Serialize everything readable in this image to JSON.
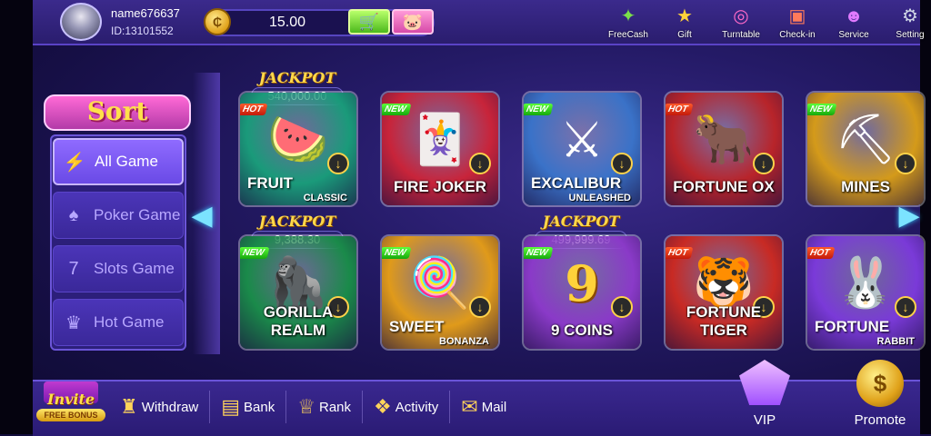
{
  "user": {
    "name": "name676637",
    "id": "ID:13101552"
  },
  "wallet": {
    "balance": "15.00"
  },
  "top_menu": [
    {
      "label": "FreeCash",
      "icon": "freecash-icon",
      "glyph": "✦",
      "color": "#7adf4a"
    },
    {
      "label": "Gift",
      "icon": "gift-icon",
      "glyph": "★",
      "color": "#ffd23a"
    },
    {
      "label": "Turntable",
      "icon": "turntable-icon",
      "glyph": "◎",
      "color": "#ff6ac8"
    },
    {
      "label": "Check-in",
      "icon": "checkin-icon",
      "glyph": "▣",
      "color": "#ff7a5a"
    },
    {
      "label": "Service",
      "icon": "service-icon",
      "glyph": "☻",
      "color": "#e07aff"
    },
    {
      "label": "Setting",
      "icon": "gear-icon",
      "glyph": "⚙",
      "color": "#cfd6e6"
    }
  ],
  "sort": {
    "title": "Sort",
    "items": [
      {
        "label": "All Game",
        "icon": "lightning-icon",
        "glyph": "⚡",
        "active": true
      },
      {
        "label": "Poker Game",
        "icon": "poker-icon",
        "glyph": "♠",
        "active": false
      },
      {
        "label": "Slots Game",
        "icon": "slots-icon",
        "glyph": "7",
        "active": false
      },
      {
        "label": "Hot Game",
        "icon": "crown-icon",
        "glyph": "♛",
        "active": false
      }
    ]
  },
  "games_row1": [
    {
      "name": "FRUIT",
      "sub": "CLASSIC",
      "badge": "HOT",
      "jackpot": "540,000.00",
      "emblem": "🍉",
      "bg": "#1a9a7a"
    },
    {
      "name": "FIRE JOKER",
      "sub": "",
      "badge": "NEW",
      "jackpot": "",
      "emblem": "🃏",
      "bg": "#c8243a"
    },
    {
      "name": "EXCALIBUR",
      "sub": "UNLEASHED",
      "badge": "NEW",
      "jackpot": "",
      "emblem": "⚔",
      "bg": "#3a72c8"
    },
    {
      "name": "FORTUNE OX",
      "sub": "",
      "badge": "HOT",
      "jackpot": "",
      "emblem": "🐂",
      "bg": "#b8242a"
    },
    {
      "name": "MINES",
      "sub": "",
      "badge": "NEW",
      "jackpot": "",
      "emblem": "⛏",
      "bg": "#d49a1a"
    }
  ],
  "games_row2": [
    {
      "name": "GORILLA REALM",
      "sub": "",
      "badge": "NEW",
      "jackpot": "9,388.30",
      "emblem": "🦍",
      "bg": "#1a8a4a"
    },
    {
      "name": "SWEET",
      "sub": "BONANZA",
      "badge": "NEW",
      "jackpot": "",
      "emblem": "🍭",
      "bg": "#e09a1a"
    },
    {
      "name": "9 COINS",
      "sub": "",
      "badge": "NEW",
      "jackpot": "499,999.69",
      "emblem": "9",
      "bg": "#8a3ac8"
    },
    {
      "name": "FORTUNE TIGER",
      "sub": "",
      "badge": "HOT",
      "jackpot": "",
      "emblem": "🐯",
      "bg": "#c82a24"
    },
    {
      "name": "FORTUNE",
      "sub": "RABBIT",
      "badge": "HOT",
      "jackpot": "",
      "emblem": "🐰",
      "bg": "#7a3ad8"
    }
  ],
  "jackpot_label": "JACKPOT",
  "bottom": {
    "invite": {
      "label": "Invite",
      "sub": "FREE BONUS"
    },
    "nav": [
      {
        "label": "Withdraw",
        "icon": "withdraw-icon",
        "glyph": "♜"
      },
      {
        "label": "Bank",
        "icon": "bank-icon",
        "glyph": "▤"
      },
      {
        "label": "Rank",
        "icon": "trophy-icon",
        "glyph": "♕"
      },
      {
        "label": "Activity",
        "icon": "activity-icon",
        "glyph": "❖"
      },
      {
        "label": "Mail",
        "icon": "mail-icon",
        "glyph": "✉"
      }
    ],
    "vip": {
      "label": "VIP",
      "glyph": "V"
    },
    "promote": {
      "label": "Promote",
      "glyph": "$"
    }
  }
}
